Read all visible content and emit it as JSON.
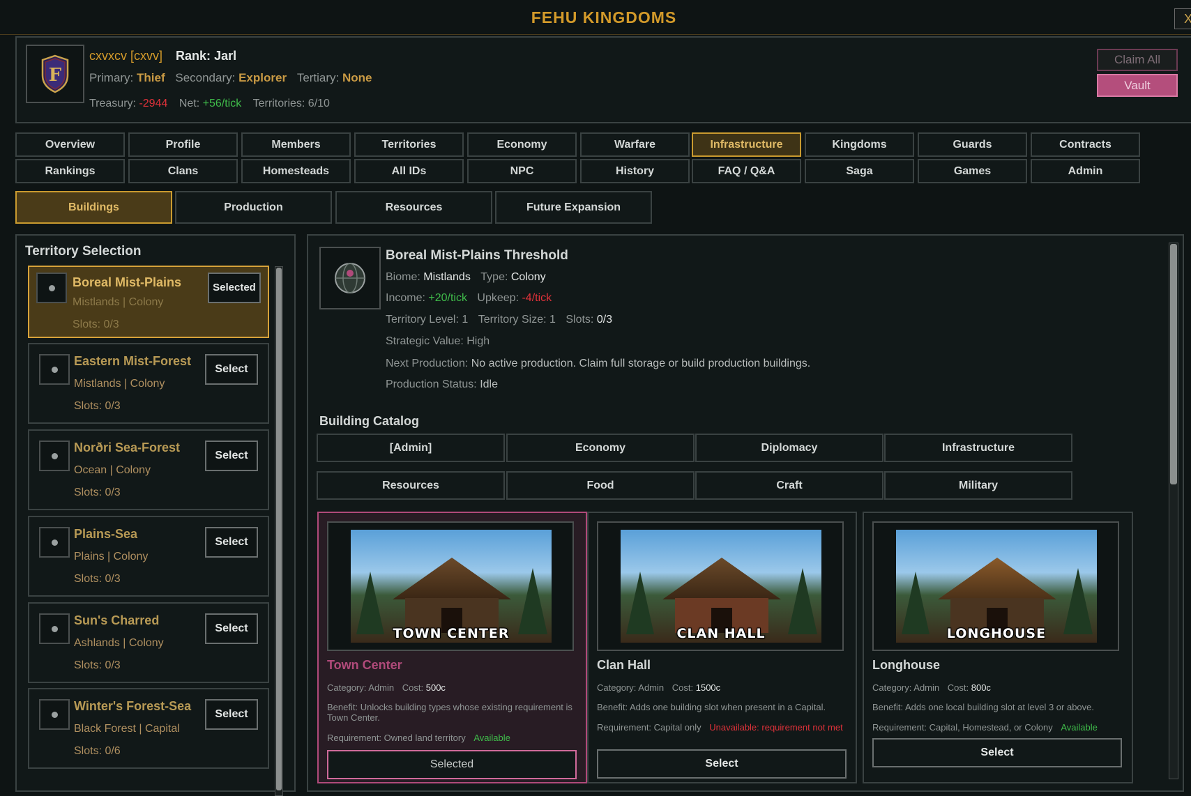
{
  "window": {
    "title": "FEHU KINGDOMS",
    "close_label": "X"
  },
  "player": {
    "name": "cxvxcv [cxvv]",
    "rank_label": "Rank:",
    "rank": "Jarl",
    "primary_label": "Primary:",
    "primary": "Thief",
    "secondary_label": "Secondary:",
    "secondary": "Explorer",
    "tertiary_label": "Tertiary:",
    "tertiary": "None",
    "treasury_label": "Treasury:",
    "treasury": "-2944",
    "net_label": "Net:",
    "net": "+56/tick",
    "territories_label": "Territories:",
    "territories": "6/10",
    "emblem_letter": "F"
  },
  "header_buttons": {
    "claim_all": "Claim All",
    "vault": "Vault"
  },
  "nav": {
    "row1": [
      "Overview",
      "Profile",
      "Members",
      "Territories",
      "Economy",
      "Warfare",
      "Infrastructure",
      "Kingdoms",
      "Guards",
      "Contracts"
    ],
    "row2": [
      "Rankings",
      "Clans",
      "Homesteads",
      "All IDs",
      "NPC",
      "History",
      "FAQ / Q&A",
      "Saga",
      "Games",
      "Admin"
    ],
    "active": "Infrastructure"
  },
  "subtabs": {
    "items": [
      "Buildings",
      "Production",
      "Resources",
      "Future Expansion"
    ],
    "active": "Buildings"
  },
  "territory_selection": {
    "heading": "Territory Selection",
    "items": [
      {
        "name": "Boreal Mist-Plains",
        "sub": "Mistlands | Colony",
        "slots": "Slots: 0/3",
        "button": "Selected"
      },
      {
        "name": "Eastern Mist-Forest",
        "sub": "Mistlands | Colony",
        "slots": "Slots: 0/3",
        "button": "Select"
      },
      {
        "name": "Norðri Sea-Forest",
        "sub": "Ocean | Colony",
        "slots": "Slots: 0/3",
        "button": "Select"
      },
      {
        "name": "Plains-Sea",
        "sub": "Plains | Colony",
        "slots": "Slots: 0/3",
        "button": "Select"
      },
      {
        "name": "Sun's Charred",
        "sub": "Ashlands | Colony",
        "slots": "Slots: 0/3",
        "button": "Select"
      },
      {
        "name": "Winter's Forest-Sea",
        "sub": "Black Forest | Capital",
        "slots": "Slots: 0/6",
        "button": "Select"
      }
    ]
  },
  "detail": {
    "title": "Boreal Mist-Plains Threshold",
    "biome_label": "Biome:",
    "biome": "Mistlands",
    "type_label": "Type:",
    "type": "Colony",
    "income_label": "Income:",
    "income": "+20/tick",
    "upkeep_label": "Upkeep:",
    "upkeep": "-4/tick",
    "level_label": "Territory Level:",
    "level": "1",
    "size_label": "Territory Size:",
    "size": "1",
    "slots_label": "Slots:",
    "slots": "0/3",
    "strategic_label": "Strategic Value:",
    "strategic": "High",
    "next_prod_label": "Next Production:",
    "next_prod": "No active production. Claim full storage or build production buildings.",
    "prod_status_label": "Production Status:",
    "prod_status": "Idle"
  },
  "catalog": {
    "heading": "Building Catalog",
    "row1": [
      "[Admin]",
      "Economy",
      "Diplomacy",
      "Infrastructure"
    ],
    "row2": [
      "Resources",
      "Food",
      "Craft",
      "Military"
    ]
  },
  "buildings": [
    {
      "image_caption": "TOWN CENTER",
      "name": "Town Center",
      "category_label": "Category:",
      "category": "Admin",
      "cost_label": "Cost:",
      "cost": "500c",
      "benefit_label": "Benefit:",
      "benefit": "Unlocks building types whose existing requirement is Town Center.",
      "req_label": "Requirement:",
      "req": "Owned land territory",
      "status": "Available",
      "button": "Selected"
    },
    {
      "image_caption": "CLAN HALL",
      "name": "Clan Hall",
      "category_label": "Category:",
      "category": "Admin",
      "cost_label": "Cost:",
      "cost": "1500c",
      "benefit_label": "Benefit:",
      "benefit": "Adds one building slot when present in a Capital.",
      "req_label": "Requirement:",
      "req": "Capital only",
      "status": "Unavailable: requirement not met",
      "button": "Select"
    },
    {
      "image_caption": "LONGHOUSE",
      "name": "Longhouse",
      "category_label": "Category:",
      "category": "Admin",
      "cost_label": "Cost:",
      "cost": "800c",
      "benefit_label": "Benefit:",
      "benefit": "Adds one local building slot at level 3 or above.",
      "req_label": "Requirement:",
      "req": "Capital, Homestead, or Colony",
      "status": "Available",
      "button": "Select"
    }
  ],
  "colors": {
    "accent_gold": "#d39a2a",
    "pink": "#b44e7c",
    "green": "#3fbb4a",
    "red": "#e0323a",
    "background": "#0e1414"
  }
}
